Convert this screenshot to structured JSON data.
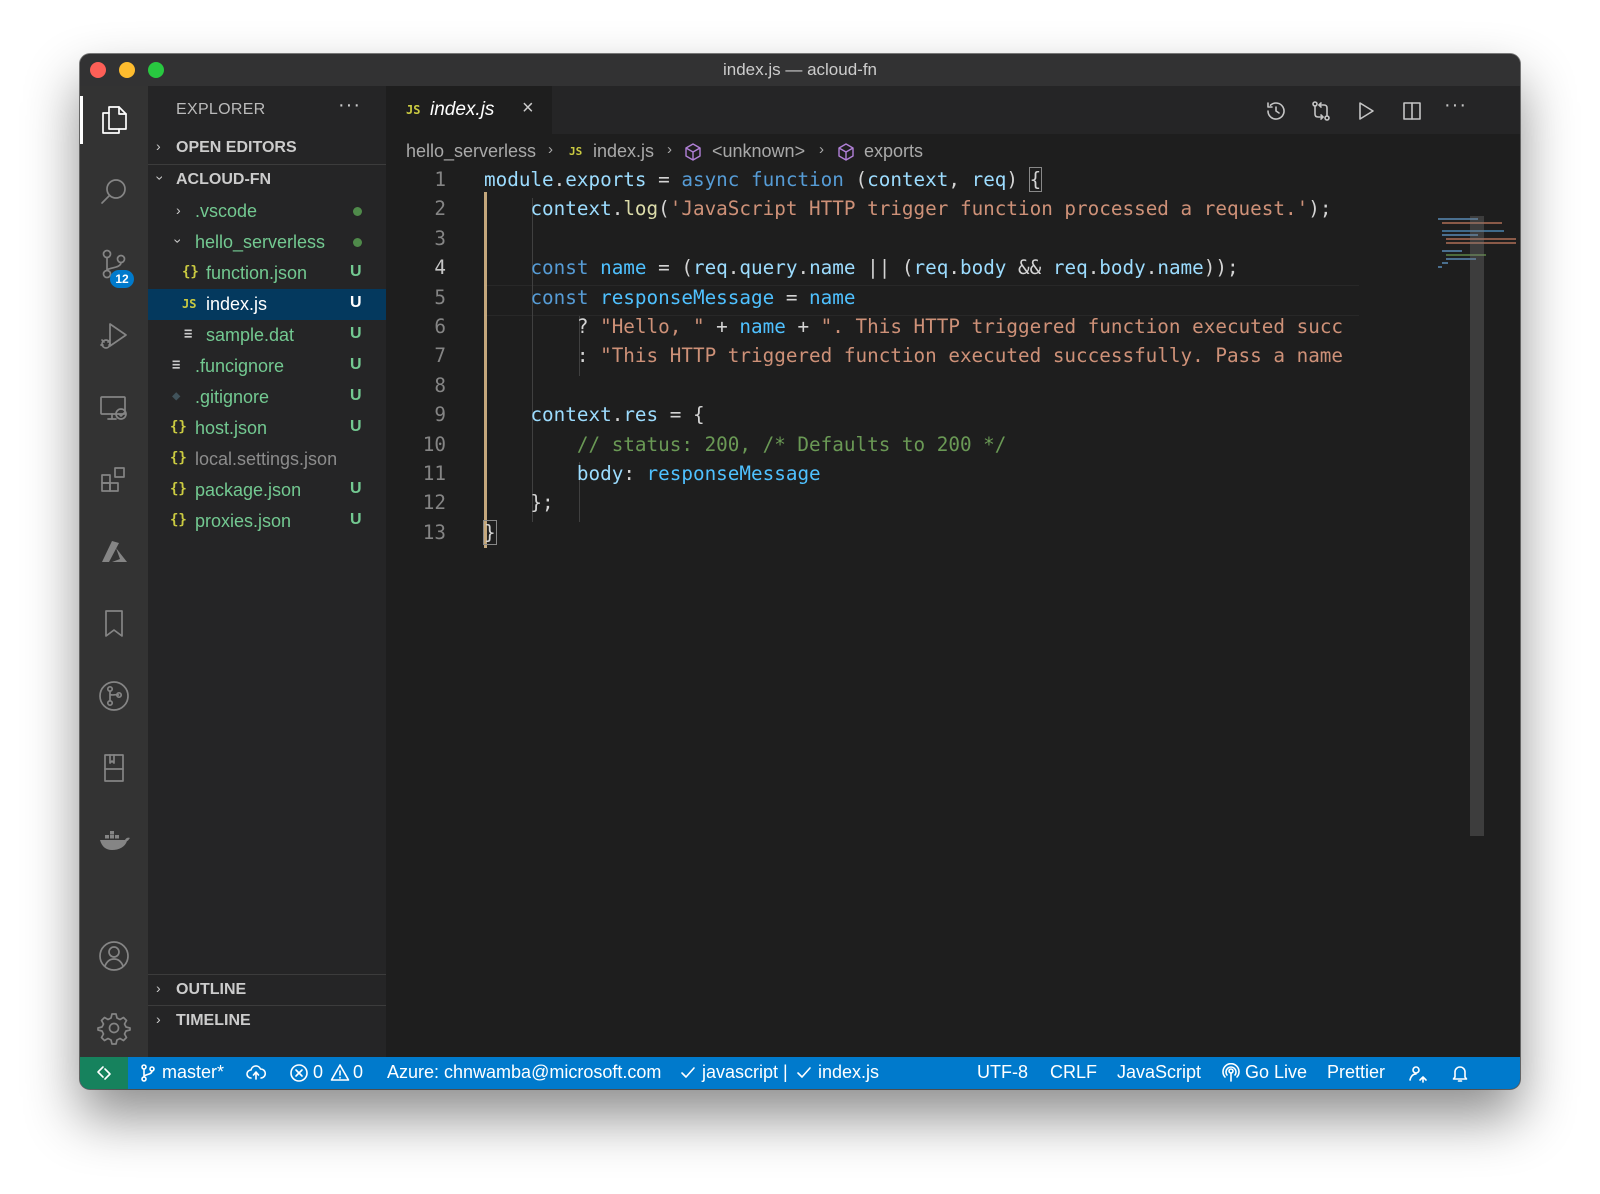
{
  "window": {
    "title": "index.js — acloud-fn"
  },
  "activity_bar": {
    "source_control_badge": "12",
    "items": [
      "explorer-icon",
      "search-icon",
      "source-control-icon",
      "run-debug-icon",
      "remote-explorer-icon",
      "extensions-icon",
      "azure-icon",
      "bookmarks-icon",
      "git-graph-icon",
      "book-icon",
      "docker-icon",
      "account-icon",
      "settings-gear-icon"
    ]
  },
  "sidebar": {
    "header": "EXPLORER",
    "more": "···",
    "open_editors": "OPEN EDITORS",
    "project": "ACLOUD-FN",
    "outline": "OUTLINE",
    "timeline": "TIMELINE",
    "files": [
      {
        "name": ".vscode",
        "status": ""
      },
      {
        "name": "hello_serverless",
        "status": ""
      },
      {
        "name": "function.json",
        "icon": "{}",
        "status": "U"
      },
      {
        "name": "index.js",
        "icon": "JS",
        "status": "U"
      },
      {
        "name": "sample.dat",
        "icon": "≡",
        "status": "U"
      },
      {
        "name": ".funcignore",
        "icon": "≡",
        "status": "U"
      },
      {
        "name": ".gitignore",
        "icon": "◆",
        "status": "U"
      },
      {
        "name": "host.json",
        "icon": "{}",
        "status": "U"
      },
      {
        "name": "local.settings.json",
        "icon": "{}",
        "status": ""
      },
      {
        "name": "package.json",
        "icon": "{}",
        "status": "U"
      },
      {
        "name": "proxies.json",
        "icon": "{}",
        "status": "U"
      }
    ]
  },
  "tab": {
    "icon": "JS",
    "name": "index.js",
    "close": "×"
  },
  "breadcrumb": {
    "folder": "hello_serverless",
    "file_icon": "JS",
    "file": "index.js",
    "symbol1": "<unknown>",
    "symbol2": "exports"
  },
  "code": {
    "line_numbers": [
      "1",
      "2",
      "3",
      "4",
      "5",
      "6",
      "7",
      "8",
      "9",
      "10",
      "11",
      "12",
      "13"
    ],
    "l1": {
      "a": "module",
      "b": ".",
      "c": "exports",
      "d": " = ",
      "e": "async",
      "f": " ",
      "g": "function",
      "h": " (",
      "i": "context",
      "j": ", ",
      "k": "req",
      "l": ") ",
      "m": "{"
    },
    "l2": {
      "a": "    ",
      "b": "context",
      "c": ".",
      "d": "log",
      "e": "(",
      "f": "'JavaScript HTTP trigger function processed a request.'",
      "g": ");"
    },
    "l4": {
      "a": "    ",
      "b": "const",
      "c": " ",
      "d": "name",
      "e": " = (",
      "f": "req",
      "g": ".",
      "h": "query",
      "i": ".",
      "j": "name",
      "k": " || (",
      "l": "req",
      "m": ".",
      "n": "body",
      "o": " && ",
      "p": "req",
      "q": ".",
      "r": "body",
      "s": ".",
      "t": "name",
      "u": "));"
    },
    "l5": {
      "a": "    ",
      "b": "const",
      "c": " ",
      "d": "responseMessage",
      "e": " = ",
      "f": "name"
    },
    "l6": {
      "a": "        ? ",
      "b": "\"Hello, \"",
      "c": " + ",
      "d": "name",
      "e": " + ",
      "f": "\". This HTTP triggered function executed succ"
    },
    "l7": {
      "a": "        : ",
      "b": "\"This HTTP triggered function executed successfully. Pass a name"
    },
    "l9": {
      "a": "    ",
      "b": "context",
      "c": ".",
      "d": "res",
      "e": " = {"
    },
    "l10": {
      "a": "        ",
      "b": "// status: 200, /* Defaults to 200 */"
    },
    "l11": {
      "a": "        ",
      "b": "body",
      "c": ": ",
      "d": "responseMessage"
    },
    "l12": {
      "a": "    };"
    },
    "l13": {
      "a": "}"
    }
  },
  "status_bar": {
    "branch": "master*",
    "errors": "0",
    "warnings": "0",
    "azure": "Azure: chnwamba@microsoft.com",
    "lint": "javascript | ",
    "lint_file": "index.js",
    "encoding": "UTF-8",
    "eol": "CRLF",
    "language": "JavaScript",
    "go_live": "Go Live",
    "formatter": "Prettier"
  },
  "colors": {
    "accent": "#007acc",
    "untracked": "#73c991",
    "selection": "#04395e"
  }
}
